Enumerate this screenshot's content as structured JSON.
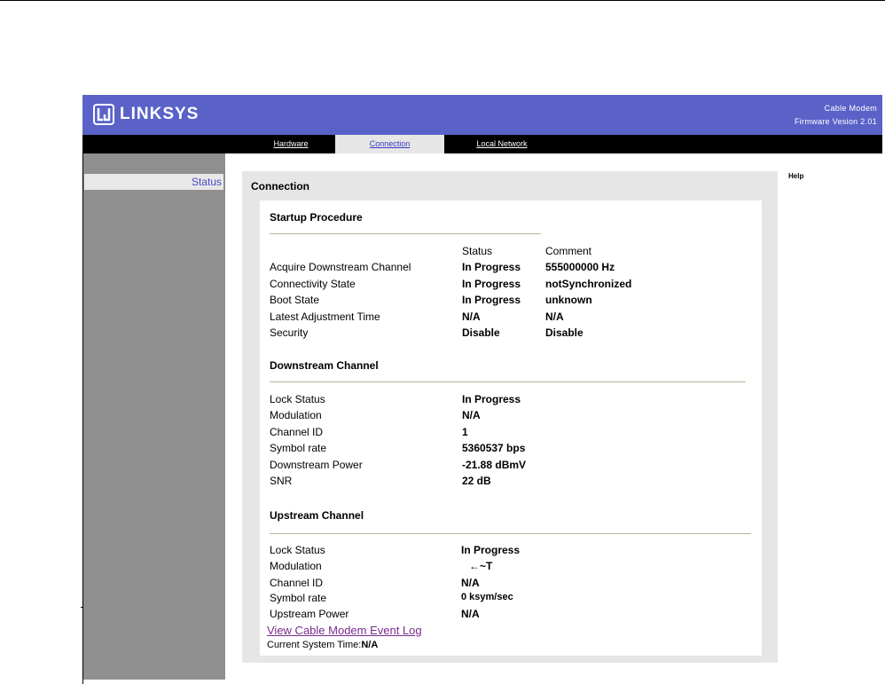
{
  "header": {
    "brand": "LINKSYS",
    "product": "Cable Modem",
    "firmware": "Firmware Vesion 2.01"
  },
  "nav": {
    "tabs": [
      {
        "label": "Hardware",
        "active": false
      },
      {
        "label": "Connection",
        "active": true
      },
      {
        "label": "Local Network",
        "active": false
      }
    ]
  },
  "sidebar": {
    "items": [
      {
        "label": "Status"
      }
    ]
  },
  "help": {
    "label": "Help"
  },
  "main": {
    "title": "Connection",
    "startup": {
      "title": "Startup Procedure",
      "col_status": "Status",
      "col_comment": "Comment",
      "rows": [
        {
          "label": "Acquire Downstream Channel",
          "status": "In Progress",
          "comment": "555000000 Hz"
        },
        {
          "label": "Connectivity State",
          "status": "In Progress",
          "comment": "notSynchronized"
        },
        {
          "label": "Boot State",
          "status": "In Progress",
          "comment": "unknown"
        },
        {
          "label": "Latest Adjustment Time",
          "status": "N/A",
          "comment": "N/A"
        },
        {
          "label": "Security",
          "status": "Disable",
          "comment": "Disable"
        }
      ]
    },
    "downstream": {
      "title": "Downstream Channel",
      "rows": [
        {
          "label": "Lock Status",
          "value": "In Progress"
        },
        {
          "label": "Modulation",
          "value": "N/A"
        },
        {
          "label": "Channel ID",
          "value": "1"
        },
        {
          "label": "Symbol rate",
          "value": "5360537 bps"
        },
        {
          "label": "Downstream Power",
          "value": "-21.88 dBmV"
        },
        {
          "label": "SNR",
          "value": "22 dB"
        }
      ]
    },
    "upstream": {
      "title": "Upstream Channel",
      "rows": [
        {
          "label": "Lock Status",
          "value": "In Progress"
        },
        {
          "label": "Modulation",
          "value": "←~T"
        },
        {
          "label": "Channel ID",
          "value": "N/A"
        },
        {
          "label": "Symbol rate",
          "value": "0 ksym/sec"
        },
        {
          "label": "Upstream Power",
          "value": "N/A"
        }
      ]
    },
    "event_log_link": "View Cable Modem Event Log",
    "system_time_label": "Current System Time:",
    "system_time_value": "N/A"
  },
  "colors": {
    "header_bg": "#5a62c8",
    "nav_bg": "#000000",
    "sidebar_bg": "#8f8f8f",
    "panel_bg": "#e6e6e6",
    "link_visited": "#7a2a8e"
  }
}
